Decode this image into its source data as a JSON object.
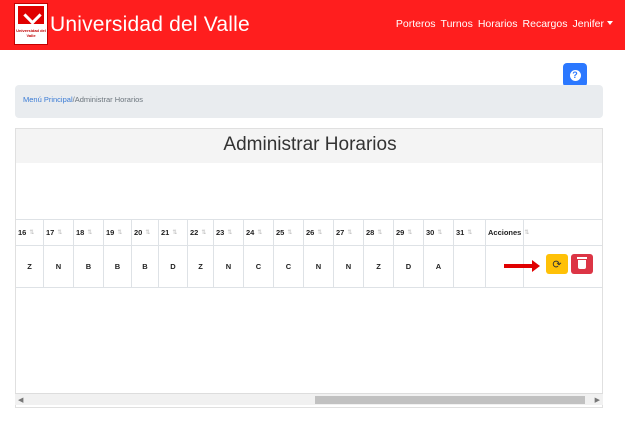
{
  "brand": {
    "logo_text": "Universidad del Valle",
    "title": "Universidad del Valle"
  },
  "nav": {
    "items": [
      "Porteros",
      "Turnos",
      "Horarios",
      "Recargos",
      "Jenifer"
    ]
  },
  "breadcrumb": {
    "home": "Menú Principal",
    "separator": "/",
    "current": "Administrar Horarios"
  },
  "page_title": "Administrar Horarios",
  "table": {
    "headers": [
      "16",
      "17",
      "18",
      "19",
      "20",
      "21",
      "22",
      "23",
      "24",
      "25",
      "26",
      "27",
      "28",
      "29",
      "30",
      "31",
      "Acciones"
    ],
    "row": [
      "Z",
      "N",
      "B",
      "B",
      "B",
      "D",
      "Z",
      "N",
      "C",
      "C",
      "N",
      "N",
      "Z",
      "D",
      "A",
      "",
      ""
    ]
  },
  "colors": {
    "navbar": "#ff1e1e",
    "help_button": "#2b78ff",
    "edit_button": "#ffc107",
    "delete_button": "#dc3545",
    "arrow": "#e00000"
  },
  "icons": {
    "help": "question-icon",
    "edit": "refresh-icon",
    "delete": "trash-icon",
    "caret": "caret-down-icon"
  }
}
